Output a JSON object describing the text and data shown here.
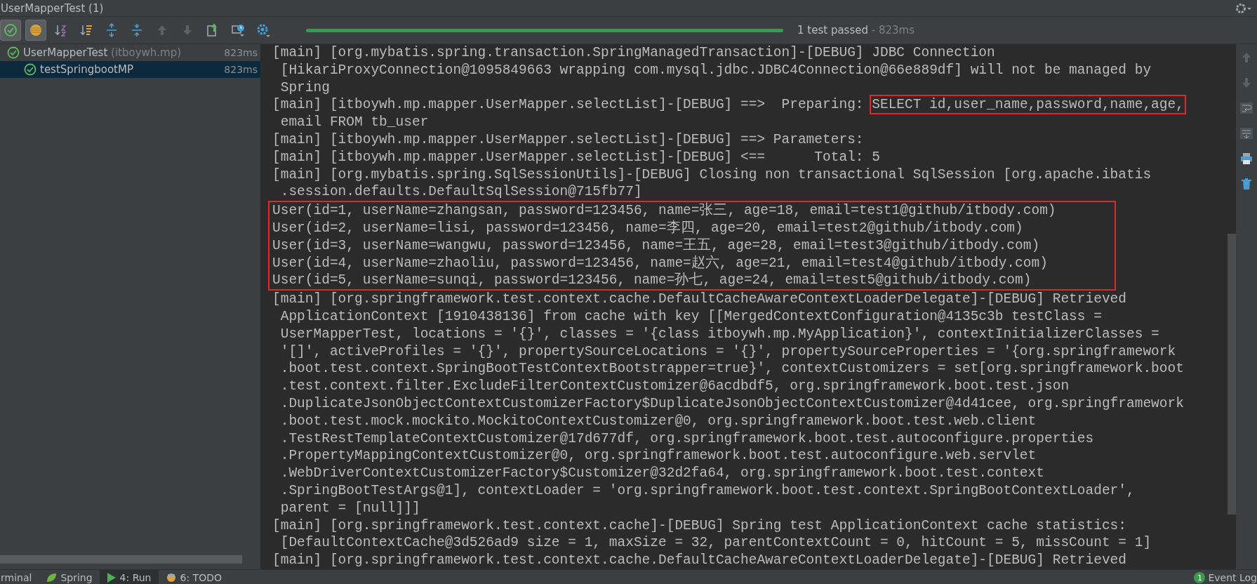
{
  "panel_title": "UserMapperTest (1)",
  "toolbar": [
    {
      "kind": "passed",
      "selected": true
    },
    {
      "kind": "ignored",
      "selected": true
    },
    {
      "kind": "sort_alpha",
      "selected": false
    },
    {
      "kind": "sort_duration",
      "selected": false
    },
    {
      "kind": "expand",
      "selected": false
    },
    {
      "kind": "collapse",
      "selected": false
    },
    {
      "kind": "up",
      "selected": false
    },
    {
      "kind": "down",
      "selected": false
    },
    {
      "kind": "export",
      "selected": false
    },
    {
      "kind": "history",
      "selected": false
    },
    {
      "kind": "settings",
      "selected": false
    }
  ],
  "progress": {
    "level": 1,
    "status": "1 test passed",
    "duration": "- 823ms"
  },
  "tree": [
    {
      "label": "UserMapperTest",
      "hint": "(itboywh.mp)",
      "time": "823ms",
      "passed": true,
      "selected": false,
      "children": [
        {
          "label": "testSpringbootMP",
          "time": "823ms",
          "passed": true,
          "selected": true
        }
      ]
    }
  ],
  "console": [
    {
      "kind": "line",
      "text": "[main] [org.mybatis.spring.transaction.SpringManagedTransaction]-[DEBUG] JDBC Connection"
    },
    {
      "kind": "line",
      "text": " [HikariProxyConnection@1095849663 wrapping com.mysql.jdbc.JDBC4Connection@66e889df] will not be managed by"
    },
    {
      "kind": "line",
      "text": " Spring"
    },
    {
      "kind": "line",
      "text": "[main] [itboywh.mp.mapper.UserMapper.selectList]-[DEBUG] ==>  Preparing: ",
      "boxed": "SELECT id,user_name,password,name,age,"
    },
    {
      "kind": "line",
      "text": " email FROM tb_user"
    },
    {
      "kind": "line",
      "text": "[main] [itboywh.mp.mapper.UserMapper.selectList]-[DEBUG] ==> Parameters: "
    },
    {
      "kind": "line",
      "text": "[main] [itboywh.mp.mapper.UserMapper.selectList]-[DEBUG] <==      Total: 5"
    },
    {
      "kind": "line",
      "text": "[main] [org.mybatis.spring.SqlSessionUtils]-[DEBUG] Closing non transactional SqlSession [org.apache.ibatis"
    },
    {
      "kind": "line",
      "text": " .session.defaults.DefaultSqlSession@715fb77]"
    },
    {
      "kind": "boxed_group",
      "lines": [
        "User(id=1, userName=zhangsan, password=123456, name=张三, age=18, email=test1@github/itbody.com)",
        "User(id=2, userName=lisi, password=123456, name=李四, age=20, email=test2@github/itbody.com)",
        "User(id=3, userName=wangwu, password=123456, name=王五, age=28, email=test3@github/itbody.com)",
        "User(id=4, userName=zhaoliu, password=123456, name=赵六, age=21, email=test4@github/itbody.com)",
        "User(id=5, userName=sunqi, password=123456, name=孙七, age=24, email=test5@github/itbody.com)"
      ]
    },
    {
      "kind": "line",
      "text": "[main] [org.springframework.test.context.cache.DefaultCacheAwareContextLoaderDelegate]-[DEBUG] Retrieved"
    },
    {
      "kind": "line",
      "text": " ApplicationContext [1910438136] from cache with key [[MergedContextConfiguration@4135c3b testClass ="
    },
    {
      "kind": "line",
      "text": " UserMapperTest, locations = '{}', classes = '{class itboywh.mp.MyApplication}', contextInitializerClasses ="
    },
    {
      "kind": "line",
      "text": " '[]', activeProfiles = '{}', propertySourceLocations = '{}', propertySourceProperties = '{org.springframework"
    },
    {
      "kind": "line",
      "text": " .boot.test.context.SpringBootTestContextBootstrapper=true}', contextCustomizers = set[org.springframework.boot"
    },
    {
      "kind": "line",
      "text": " .test.context.filter.ExcludeFilterContextCustomizer@6acdbdf5, org.springframework.boot.test.json"
    },
    {
      "kind": "line",
      "text": " .DuplicateJsonObjectContextCustomizerFactory$DuplicateJsonObjectContextCustomizer@4d41cee, org.springframework"
    },
    {
      "kind": "line",
      "text": " .boot.test.mock.mockito.MockitoContextCustomizer@0, org.springframework.boot.test.web.client"
    },
    {
      "kind": "line",
      "text": " .TestRestTemplateContextCustomizer@17d677df, org.springframework.boot.test.autoconfigure.properties"
    },
    {
      "kind": "line",
      "text": " .PropertyMappingContextCustomizer@0, org.springframework.boot.test.autoconfigure.web.servlet"
    },
    {
      "kind": "line",
      "text": " .WebDriverContextCustomizerFactory$Customizer@32d2fa64, org.springframework.boot.test.context"
    },
    {
      "kind": "line",
      "text": " .SpringBootTestArgs@1], contextLoader = 'org.springframework.boot.test.context.SpringBootContextLoader',"
    },
    {
      "kind": "line",
      "text": " parent = [null]]]"
    },
    {
      "kind": "line",
      "text": "[main] [org.springframework.test.context.cache]-[DEBUG] Spring test ApplicationContext cache statistics:"
    },
    {
      "kind": "line",
      "text": " [DefaultContextCache@3d526ad9 size = 1, maxSize = 32, parentContextCount = 0, hitCount = 5, missCount = 1]"
    },
    {
      "kind": "line",
      "text": "[main] [org.springframework.test.context.cache.DefaultCacheAwareContextLoaderDelegate]-[DEBUG] Retrieved"
    }
  ],
  "side_tools": [
    {
      "kind": "up"
    },
    {
      "kind": "down"
    },
    {
      "kind": "wrap"
    },
    {
      "kind": "scroll_end"
    },
    {
      "kind": "print"
    },
    {
      "kind": "trash"
    }
  ],
  "bottom_tabs": [
    {
      "label": "rminal",
      "kind": "plain",
      "selected": false
    },
    {
      "label": "Spring",
      "kind": "leaf",
      "selected": false
    },
    {
      "label": "4: Run",
      "kind": "run",
      "selected": true
    },
    {
      "label": "6: TODO",
      "kind": "todo",
      "selected": false
    }
  ],
  "event_log": {
    "badge": "1",
    "label": "Event Log"
  }
}
